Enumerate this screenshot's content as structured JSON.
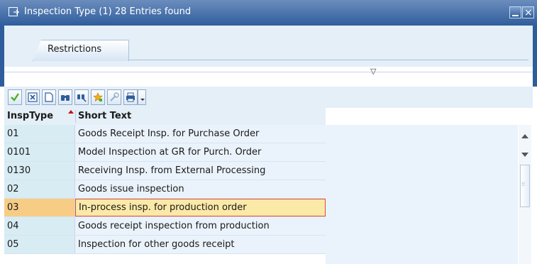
{
  "window": {
    "title": "Inspection Type (1)   28 Entries found"
  },
  "tabs": [
    {
      "label": "Restrictions"
    }
  ],
  "toolbar": {
    "buttons": [
      {
        "icon": "checkmark-icon"
      },
      {
        "icon": "cancel-icon"
      },
      {
        "icon": "new-document-icon"
      },
      {
        "icon": "find-icon"
      },
      {
        "icon": "find-next-icon"
      },
      {
        "icon": "favorites-add-icon"
      },
      {
        "icon": "help-icon"
      },
      {
        "icon": "print-icon"
      }
    ]
  },
  "table": {
    "columns": [
      "InspType",
      "Short Text"
    ],
    "rows": [
      {
        "code": "01",
        "text": "Goods Receipt Insp. for Purchase Order"
      },
      {
        "code": "0101",
        "text": "Model Inspection at GR for Purch. Order"
      },
      {
        "code": "0130",
        "text": "Receiving Insp. from External Processing"
      },
      {
        "code": "02",
        "text": "Goods issue inspection"
      },
      {
        "code": "03",
        "text": "In-process insp. for production order"
      },
      {
        "code": "04",
        "text": "Goods receipt inspection from production"
      },
      {
        "code": "05",
        "text": "Inspection for other goods receipt"
      }
    ],
    "selected_row": 4
  },
  "colors": {
    "title_bar": "#2f5d9c",
    "panel_bg": "#e4eff8",
    "key_column_bg": "#d8ecf4",
    "selected_row_bg": "#f7cd86",
    "selected_cell_border": "#e34b3a",
    "sort_marker": "#cc1111"
  }
}
